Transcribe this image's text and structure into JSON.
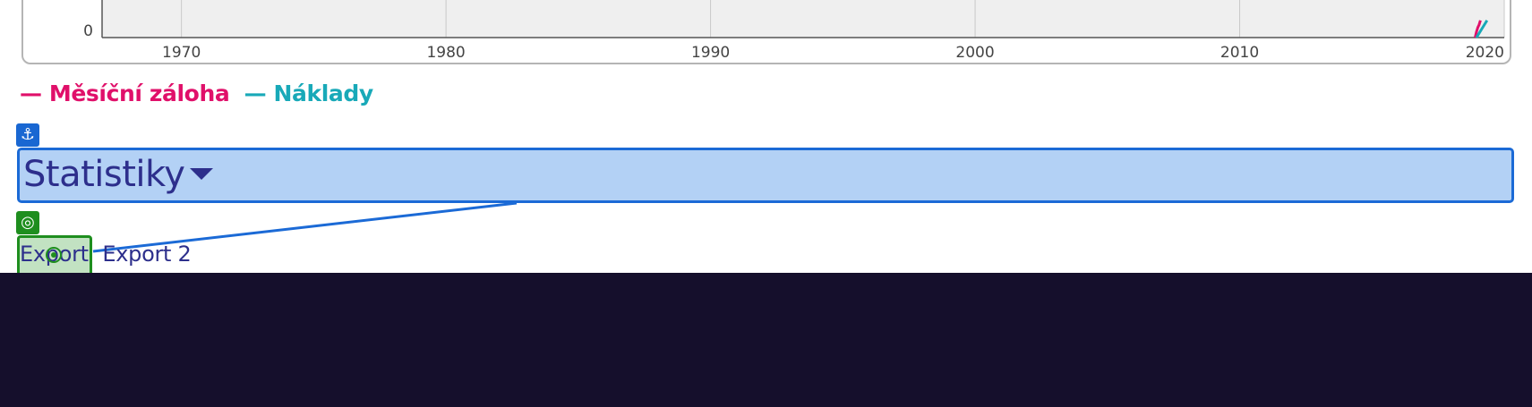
{
  "chart_data": {
    "type": "line",
    "x_ticks": [
      "1970",
      "1980",
      "1990",
      "2000",
      "2010",
      "2020"
    ],
    "xlim": [
      1967,
      2020
    ],
    "y_ticks": [
      "0"
    ],
    "grid": true,
    "legend_placement": "bottom-left",
    "series": [
      {
        "name": "Měsíční záloha",
        "color": "#e0106a",
        "points": [
          {
            "x": 2018.9,
            "y": 0
          },
          {
            "x": 2018.95,
            "y": 4
          },
          {
            "x": 2019.0,
            "y": 7
          },
          {
            "x": 2019.05,
            "y": 9
          },
          {
            "x": 2019.1,
            "y": 12
          }
        ]
      },
      {
        "name": "Náklady",
        "color": "#18a9b8",
        "points": [
          {
            "x": 2018.95,
            "y": 0
          },
          {
            "x": 2019.05,
            "y": 3
          },
          {
            "x": 2019.15,
            "y": 6
          },
          {
            "x": 2019.25,
            "y": 9
          },
          {
            "x": 2019.35,
            "y": 12
          }
        ]
      }
    ]
  },
  "legend": {
    "series1": "— Měsíční záloha",
    "series2": "— Náklady",
    "series1_color": "#e0106a",
    "series2_color": "#18a9b8"
  },
  "badges": {
    "anchor_icon": "anchor-icon",
    "anchor_glyph": "⚓",
    "target_icon": "target-icon",
    "target_glyph": "◎"
  },
  "statistics": {
    "title": "Statistiky",
    "caret_icon": "caret-down-icon"
  },
  "export_tabs": [
    "Export",
    "Export 2"
  ],
  "colors": {
    "accent": "#1b6ad6",
    "highlight_green": "#1e8e1e",
    "heading_bg": "#b3d1f5",
    "footer_bg": "#150f2c",
    "text_primary": "#2d2f8c"
  }
}
